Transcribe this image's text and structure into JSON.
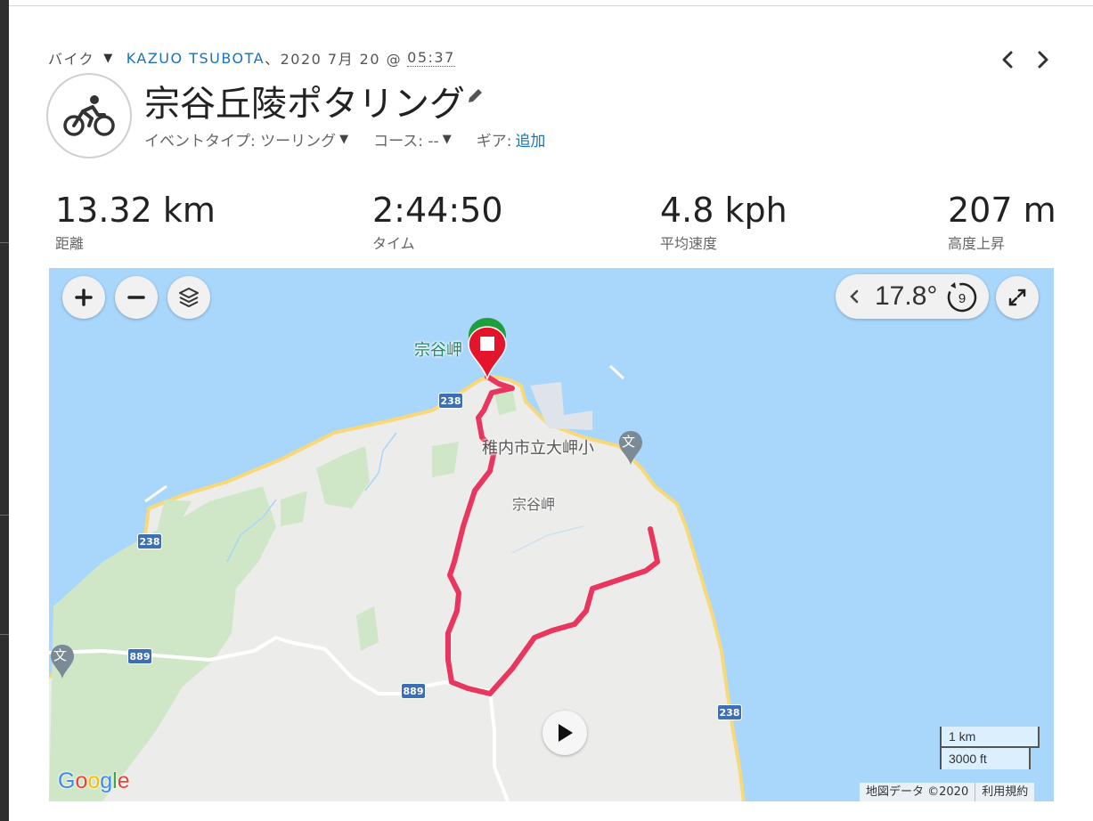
{
  "header": {
    "activity_type": "バイク",
    "activity_type_caret": "▼",
    "owner": "KAZUO TSUBOTA",
    "date_prefix": "、2020 7月 20 @",
    "time": "05:37",
    "title": "宗谷丘陵ポタリング",
    "event_type_label": "イベントタイプ: ツーリング",
    "course_label": "コース: --",
    "gear_label": "ギア:",
    "gear_add": "追加",
    "dropdown_caret": "▼"
  },
  "stats": [
    {
      "value": "13.32 km",
      "label": "距離"
    },
    {
      "value": "2:44:50",
      "label": "タイム"
    },
    {
      "value": "4.8 kph",
      "label": "平均速度"
    },
    {
      "value": "207 m",
      "label": "高度上昇"
    }
  ],
  "map": {
    "rotation_value": "17.8°",
    "rotation_step": "9",
    "labels": {
      "cape": "宗谷岬",
      "school": "稚内市立大岬小",
      "area": "宗谷岬"
    },
    "route_shields": [
      "238",
      "238",
      "238",
      "889",
      "889",
      "238"
    ],
    "poi_icon_text": "文",
    "google_logo": [
      "G",
      "o",
      "o",
      "g",
      "l",
      "e"
    ],
    "scale_km": "1 km",
    "scale_ft": "3000 ft",
    "attribution": "地図データ ©2020",
    "terms": "利用規約",
    "route_color": "#e8365f",
    "water_color": "#a9d6fb",
    "land_color": "#ececea"
  }
}
